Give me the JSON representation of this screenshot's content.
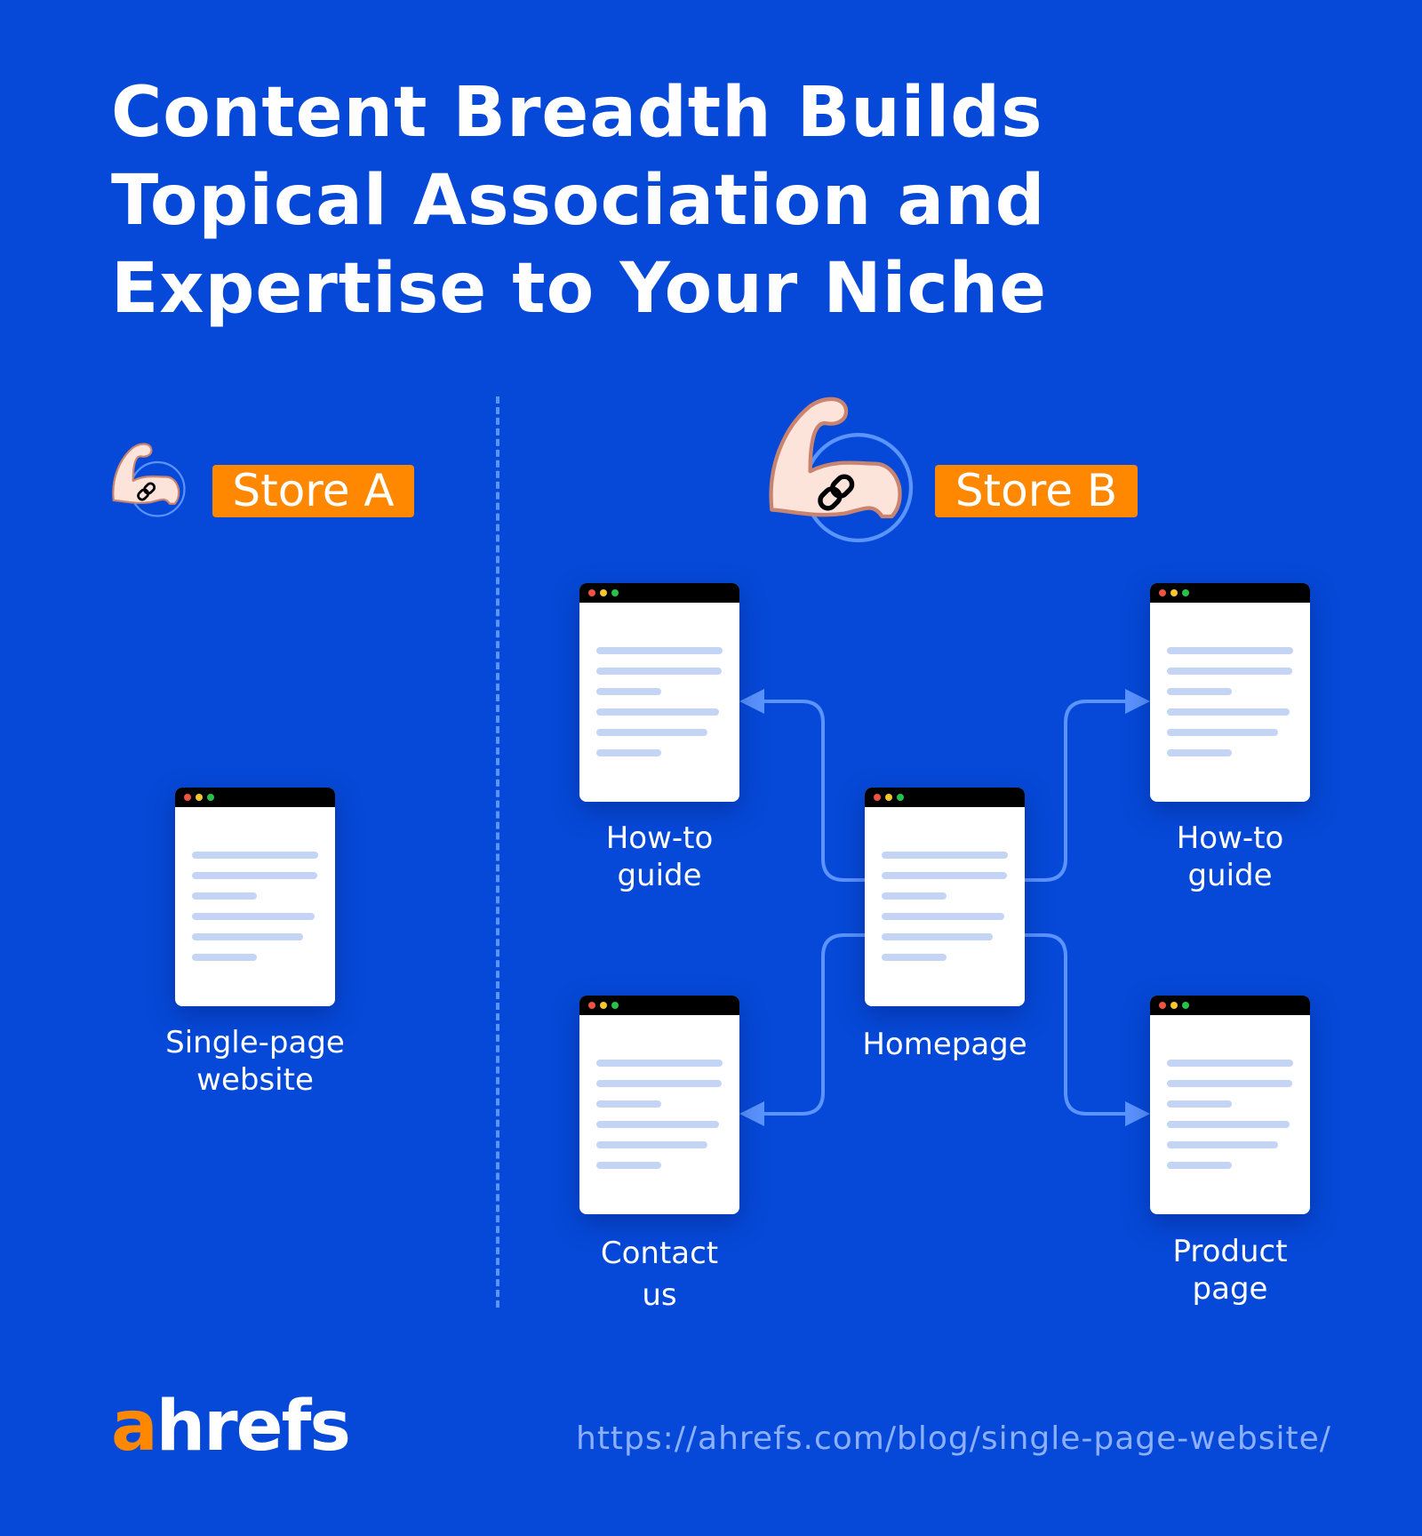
{
  "title": {
    "lines": [
      "Content Breadth Builds",
      "Topical Association and",
      "Expertise to Your Niche"
    ]
  },
  "store_a": {
    "badge": "Store A",
    "icon": "flexed-arm-link-icon",
    "page_label": [
      "Single-page",
      "website"
    ]
  },
  "store_b": {
    "badge": "Store B",
    "icon": "flexed-arm-link-icon",
    "pages": {
      "homepage": [
        "Homepage"
      ],
      "howto_left": [
        "How-to",
        "guide"
      ],
      "howto_right": [
        "How-to",
        "guide"
      ],
      "contact": [
        "Contact",
        "us"
      ],
      "product": [
        "Product",
        "page"
      ]
    }
  },
  "colors": {
    "background": "#0649d8",
    "badge": "#ff8800",
    "arrow": "#5b94ff",
    "page_line": "#c4d4f5"
  },
  "footer": {
    "logo_a": "a",
    "logo_rest": "hrefs",
    "url": "https://ahrefs.com/blog/single-page-website/"
  }
}
